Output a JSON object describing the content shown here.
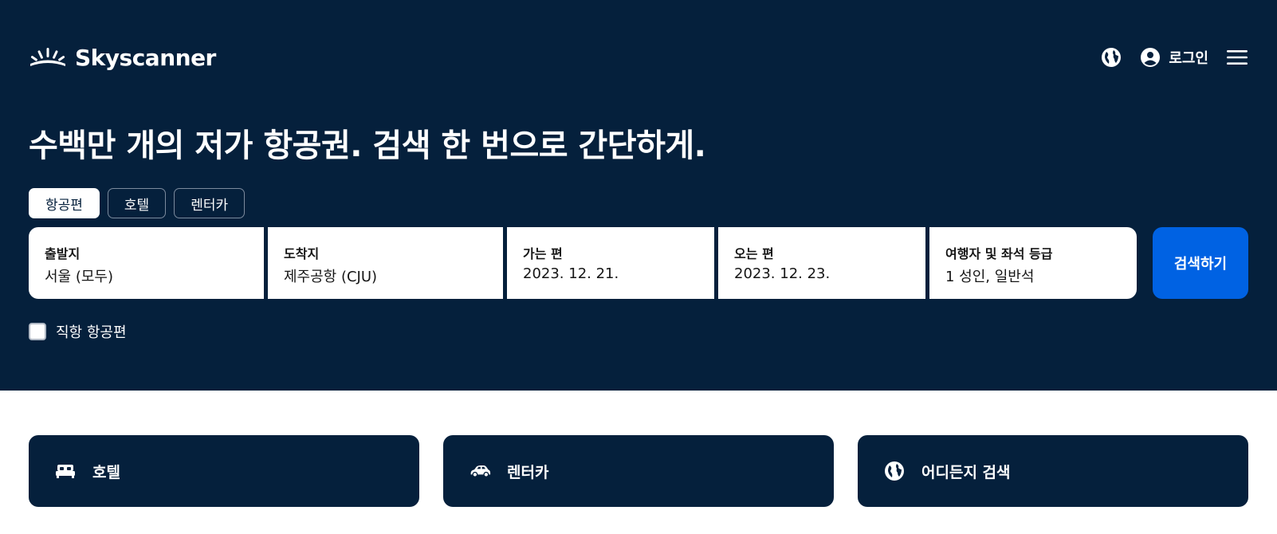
{
  "brand": {
    "name": "Skyscanner"
  },
  "header": {
    "login_label": "로그인",
    "icons": [
      "globe-icon",
      "account-icon",
      "menu-icon"
    ]
  },
  "hero": {
    "headline": "수백만 개의 저가 항공권. 검색 한 번으로 간단하게."
  },
  "tabs": [
    {
      "label": "항공편",
      "active": true
    },
    {
      "label": "호텔",
      "active": false
    },
    {
      "label": "렌터카",
      "active": false
    }
  ],
  "search": {
    "origin": {
      "label": "출발지",
      "value": "서울 (모두)"
    },
    "destination": {
      "label": "도착지",
      "value": "제주공항 (CJU)"
    },
    "depart": {
      "label": "가는 편",
      "value": "2023. 12. 21."
    },
    "return": {
      "label": "오는 편",
      "value": "2023. 12. 23."
    },
    "travellers": {
      "label": "여행자 및 좌석 등급",
      "value": "1 성인, 일반석"
    },
    "button_label": "검색하기"
  },
  "direct_flights": {
    "label": "직항 항공편",
    "checked": false
  },
  "cards": [
    {
      "label": "호텔",
      "icon": "bed-icon"
    },
    {
      "label": "렌터카",
      "icon": "car-icon"
    },
    {
      "label": "어디든지 검색",
      "icon": "globe-icon"
    }
  ],
  "colors": {
    "hero_bg": "#05203c",
    "primary_button": "#0062e3",
    "white": "#ffffff"
  }
}
